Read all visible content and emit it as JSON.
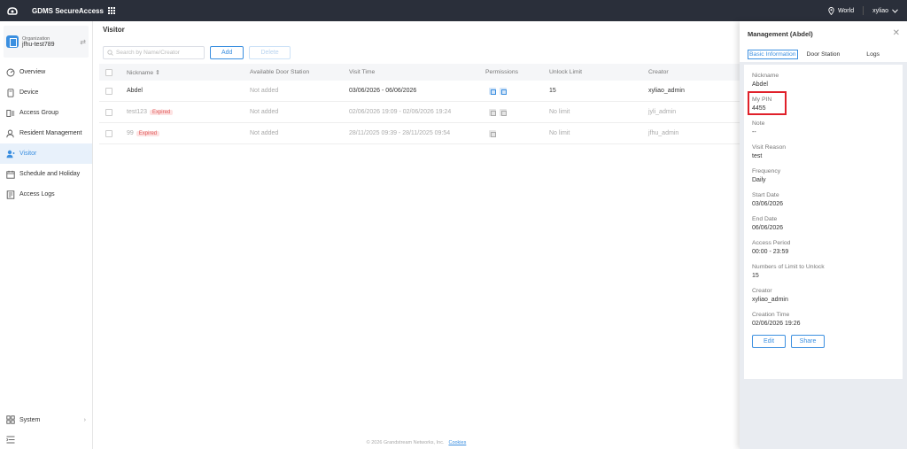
{
  "topbar": {
    "app_title": "GDMS SecureAccess",
    "region": "World",
    "user": "xyliao"
  },
  "sidebar": {
    "org_label": "Organization",
    "org_name": "jfhu-test789",
    "items": [
      {
        "label": "Overview",
        "icon": "overview-icon"
      },
      {
        "label": "Device",
        "icon": "device-icon"
      },
      {
        "label": "Access Group",
        "icon": "access-group-icon"
      },
      {
        "label": "Resident Management",
        "icon": "resident-icon"
      },
      {
        "label": "Visitor",
        "icon": "visitor-icon",
        "active": true
      },
      {
        "label": "Schedule and Holiday",
        "icon": "calendar-icon"
      },
      {
        "label": "Access Logs",
        "icon": "logs-icon"
      }
    ],
    "system_label": "System"
  },
  "main": {
    "title": "Visitor",
    "search_placeholder": "Search by Name/Creator",
    "add_label": "Add",
    "delete_label": "Delete",
    "columns": [
      "Nickname",
      "Available Door Station",
      "Visit Time",
      "Permissions",
      "Unlock Limit",
      "Creator"
    ],
    "rows": [
      {
        "nickname": "Abdel",
        "expired": "",
        "door": "Not added",
        "visit": "03/06/2026 - 06/06/2026",
        "unlock": "15",
        "creator": "xyliao_admin"
      },
      {
        "nickname": "test123",
        "expired": "Expired",
        "door": "Not added",
        "visit": "02/06/2026 19:09 - 02/06/2026 19:24",
        "unlock": "No limit",
        "creator": "jyli_admin"
      },
      {
        "nickname": "99",
        "expired": "Expired",
        "door": "Not added",
        "visit": "28/11/2025 09:39 - 28/11/2025 09:54",
        "unlock": "No limit",
        "creator": "jfhu_admin"
      }
    ],
    "footer_text": "© 2026 Grandstream Networks, Inc.",
    "footer_link": "Cookies"
  },
  "panel": {
    "title": "Management (Abdel)",
    "tabs": [
      "Basic Information",
      "Door Station",
      "Logs"
    ],
    "fields": [
      {
        "label": "Nickname",
        "value": "Abdel"
      },
      {
        "label": "My PIN",
        "value": "4455"
      },
      {
        "label": "Note",
        "value": "--"
      },
      {
        "label": "Visit Reason",
        "value": "test"
      },
      {
        "label": "Frequency",
        "value": "Daily"
      },
      {
        "label": "Start Date",
        "value": "03/06/2026"
      },
      {
        "label": "End Date",
        "value": "06/06/2026"
      },
      {
        "label": "Access Period",
        "value": "00:00 - 23:59"
      },
      {
        "label": "Numbers of Limit to Unlock",
        "value": "15"
      },
      {
        "label": "Creator",
        "value": "xyliao_admin"
      },
      {
        "label": "Creation Time",
        "value": "02/06/2026 19:26"
      }
    ],
    "edit_label": "Edit",
    "share_label": "Share"
  },
  "colors": {
    "accent": "#3b8fe0",
    "topbar": "#2a2f3a",
    "expired_bg": "#fde2e2",
    "highlight": "#e0202a"
  }
}
